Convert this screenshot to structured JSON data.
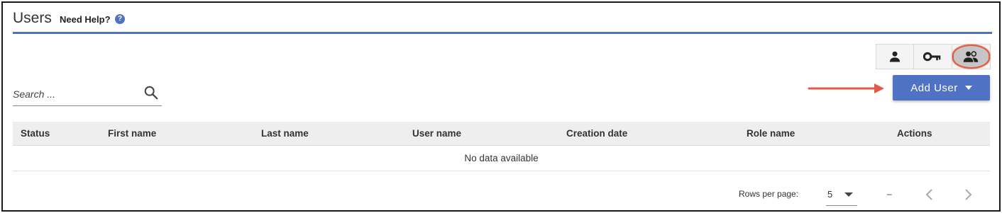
{
  "header": {
    "title": "Users",
    "help_label": "Need Help?",
    "help_icon_glyph": "?",
    "accent_color": "#4f72c4"
  },
  "view_toggles": [
    {
      "icon": "person-icon",
      "active": false
    },
    {
      "icon": "key-icon",
      "active": false
    },
    {
      "icon": "people-icon",
      "active": true
    }
  ],
  "search": {
    "placeholder": "Search ...",
    "value": ""
  },
  "add_user": {
    "label": "Add User",
    "color": "#4f72c4"
  },
  "annotations": {
    "arrow_color": "#e05a47",
    "highlight_color": "#e05a47"
  },
  "table": {
    "columns": [
      "Status",
      "First name",
      "Last name",
      "User name",
      "Creation date",
      "Role name",
      "Actions"
    ],
    "empty_text": "No data available"
  },
  "pagination": {
    "rows_per_page_label": "Rows per page:",
    "rows_per_page_value": "5",
    "range_text": "–"
  }
}
